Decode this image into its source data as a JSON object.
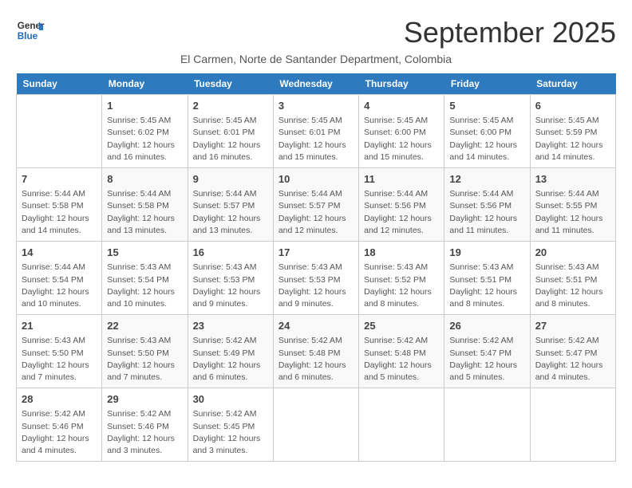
{
  "header": {
    "logo_line1": "General",
    "logo_line2": "Blue",
    "month": "September 2025",
    "subtitle": "El Carmen, Norte de Santander Department, Colombia"
  },
  "days_of_week": [
    "Sunday",
    "Monday",
    "Tuesday",
    "Wednesday",
    "Thursday",
    "Friday",
    "Saturday"
  ],
  "weeks": [
    [
      {
        "day": "",
        "info": ""
      },
      {
        "day": "1",
        "info": "Sunrise: 5:45 AM\nSunset: 6:02 PM\nDaylight: 12 hours\nand 16 minutes."
      },
      {
        "day": "2",
        "info": "Sunrise: 5:45 AM\nSunset: 6:01 PM\nDaylight: 12 hours\nand 16 minutes."
      },
      {
        "day": "3",
        "info": "Sunrise: 5:45 AM\nSunset: 6:01 PM\nDaylight: 12 hours\nand 15 minutes."
      },
      {
        "day": "4",
        "info": "Sunrise: 5:45 AM\nSunset: 6:00 PM\nDaylight: 12 hours\nand 15 minutes."
      },
      {
        "day": "5",
        "info": "Sunrise: 5:45 AM\nSunset: 6:00 PM\nDaylight: 12 hours\nand 14 minutes."
      },
      {
        "day": "6",
        "info": "Sunrise: 5:45 AM\nSunset: 5:59 PM\nDaylight: 12 hours\nand 14 minutes."
      }
    ],
    [
      {
        "day": "7",
        "info": "Sunrise: 5:44 AM\nSunset: 5:58 PM\nDaylight: 12 hours\nand 14 minutes."
      },
      {
        "day": "8",
        "info": "Sunrise: 5:44 AM\nSunset: 5:58 PM\nDaylight: 12 hours\nand 13 minutes."
      },
      {
        "day": "9",
        "info": "Sunrise: 5:44 AM\nSunset: 5:57 PM\nDaylight: 12 hours\nand 13 minutes."
      },
      {
        "day": "10",
        "info": "Sunrise: 5:44 AM\nSunset: 5:57 PM\nDaylight: 12 hours\nand 12 minutes."
      },
      {
        "day": "11",
        "info": "Sunrise: 5:44 AM\nSunset: 5:56 PM\nDaylight: 12 hours\nand 12 minutes."
      },
      {
        "day": "12",
        "info": "Sunrise: 5:44 AM\nSunset: 5:56 PM\nDaylight: 12 hours\nand 11 minutes."
      },
      {
        "day": "13",
        "info": "Sunrise: 5:44 AM\nSunset: 5:55 PM\nDaylight: 12 hours\nand 11 minutes."
      }
    ],
    [
      {
        "day": "14",
        "info": "Sunrise: 5:44 AM\nSunset: 5:54 PM\nDaylight: 12 hours\nand 10 minutes."
      },
      {
        "day": "15",
        "info": "Sunrise: 5:43 AM\nSunset: 5:54 PM\nDaylight: 12 hours\nand 10 minutes."
      },
      {
        "day": "16",
        "info": "Sunrise: 5:43 AM\nSunset: 5:53 PM\nDaylight: 12 hours\nand 9 minutes."
      },
      {
        "day": "17",
        "info": "Sunrise: 5:43 AM\nSunset: 5:53 PM\nDaylight: 12 hours\nand 9 minutes."
      },
      {
        "day": "18",
        "info": "Sunrise: 5:43 AM\nSunset: 5:52 PM\nDaylight: 12 hours\nand 8 minutes."
      },
      {
        "day": "19",
        "info": "Sunrise: 5:43 AM\nSunset: 5:51 PM\nDaylight: 12 hours\nand 8 minutes."
      },
      {
        "day": "20",
        "info": "Sunrise: 5:43 AM\nSunset: 5:51 PM\nDaylight: 12 hours\nand 8 minutes."
      }
    ],
    [
      {
        "day": "21",
        "info": "Sunrise: 5:43 AM\nSunset: 5:50 PM\nDaylight: 12 hours\nand 7 minutes."
      },
      {
        "day": "22",
        "info": "Sunrise: 5:43 AM\nSunset: 5:50 PM\nDaylight: 12 hours\nand 7 minutes."
      },
      {
        "day": "23",
        "info": "Sunrise: 5:42 AM\nSunset: 5:49 PM\nDaylight: 12 hours\nand 6 minutes."
      },
      {
        "day": "24",
        "info": "Sunrise: 5:42 AM\nSunset: 5:48 PM\nDaylight: 12 hours\nand 6 minutes."
      },
      {
        "day": "25",
        "info": "Sunrise: 5:42 AM\nSunset: 5:48 PM\nDaylight: 12 hours\nand 5 minutes."
      },
      {
        "day": "26",
        "info": "Sunrise: 5:42 AM\nSunset: 5:47 PM\nDaylight: 12 hours\nand 5 minutes."
      },
      {
        "day": "27",
        "info": "Sunrise: 5:42 AM\nSunset: 5:47 PM\nDaylight: 12 hours\nand 4 minutes."
      }
    ],
    [
      {
        "day": "28",
        "info": "Sunrise: 5:42 AM\nSunset: 5:46 PM\nDaylight: 12 hours\nand 4 minutes."
      },
      {
        "day": "29",
        "info": "Sunrise: 5:42 AM\nSunset: 5:46 PM\nDaylight: 12 hours\nand 3 minutes."
      },
      {
        "day": "30",
        "info": "Sunrise: 5:42 AM\nSunset: 5:45 PM\nDaylight: 12 hours\nand 3 minutes."
      },
      {
        "day": "",
        "info": ""
      },
      {
        "day": "",
        "info": ""
      },
      {
        "day": "",
        "info": ""
      },
      {
        "day": "",
        "info": ""
      }
    ]
  ]
}
